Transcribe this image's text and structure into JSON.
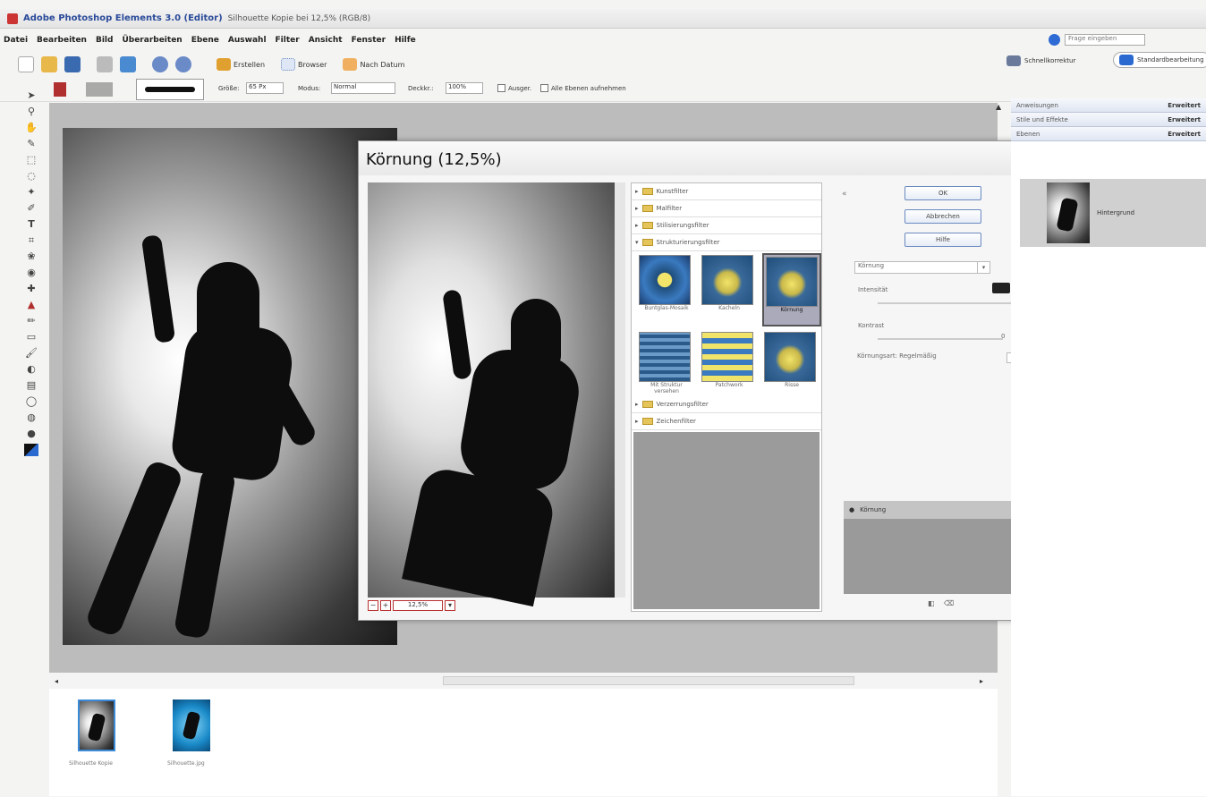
{
  "app": {
    "title": "Adobe Photoshop Elements 3.0 (Editor)",
    "doc": "Silhouette Kopie bei 12,5% (RGB/8)"
  },
  "menu": [
    "Datei",
    "Bearbeiten",
    "Bild",
    "Überarbeiten",
    "Ebene",
    "Auswahl",
    "Filter",
    "Ansicht",
    "Fenster",
    "Hilfe"
  ],
  "toolbar": {
    "create": "Erstellen",
    "browse": "Browser",
    "date": "Nach Datum",
    "help_placeholder": "Frage eingeben",
    "quickfix": "Schnellkorrektur",
    "standard": "Standardbearbeitung"
  },
  "options": {
    "size": "Größe:",
    "size_val": "65 Px",
    "mode": "Modus:",
    "mode_val": "Normal",
    "opacity": "Deckkr.:",
    "opacity_val": "100%",
    "aligned": "Ausger.",
    "all_layers": "Alle Ebenen aufnehmen"
  },
  "dialog": {
    "title": "Körnung (12,5%)",
    "zoom": "12,5%",
    "ok": "OK",
    "cancel": "Abbrechen",
    "help": "Hilfe",
    "filter_select": "Körnung",
    "intensity": "Intensität",
    "contrast": "Kontrast",
    "contrast_val": "0",
    "type_label": "Körnungsart: Regelmäßig",
    "layer_name": "Körnung",
    "categories": [
      "Kunstfilter",
      "Malfilter",
      "Stilisierungsfilter",
      "Strukturierungsfilter",
      "Verzerrungsfilter",
      "Zeichenfilter"
    ],
    "thumbs": [
      "Buntglas-Mosaik",
      "Kacheln",
      "Körnung",
      "Mit Struktur versehen",
      "Patchwork",
      "Risse"
    ]
  },
  "palette": {
    "items": [
      "Anweisungen",
      "Stile und Effekte",
      "Ebenen"
    ],
    "right": "Erweitert",
    "layer": "Hintergrund"
  },
  "bin": [
    {
      "label": "Silhouette Kopie"
    },
    {
      "label": "Silhouette.jpg"
    }
  ]
}
